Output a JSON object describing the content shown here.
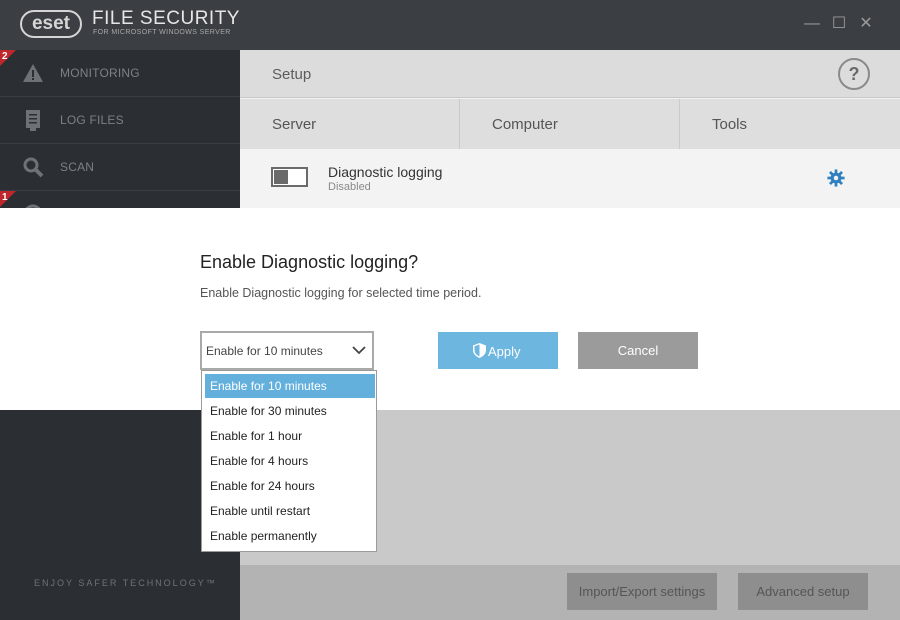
{
  "titlebar": {
    "logo_text": "eset",
    "product_name": "FILE SECURITY",
    "product_subtitle": "FOR MICROSOFT WINDOWS SERVER",
    "minimize_glyph": "—",
    "maximize_glyph": "☐",
    "close_glyph": "✕"
  },
  "sidebar": {
    "items": [
      {
        "label": "MONITORING",
        "icon": "warning-icon",
        "badge": "2"
      },
      {
        "label": "LOG FILES",
        "icon": "log-files-icon",
        "badge": ""
      },
      {
        "label": "SCAN",
        "icon": "search-icon",
        "badge": ""
      },
      {
        "label": "",
        "icon": "update-icon",
        "badge": "1"
      }
    ],
    "tagline": "ENJOY SAFER TECHNOLOGY™"
  },
  "main": {
    "title": "Setup",
    "help_glyph": "?",
    "tabs": [
      {
        "label": "Server"
      },
      {
        "label": "Computer"
      },
      {
        "label": "Tools"
      }
    ],
    "diagnostic_row": {
      "title": "Diagnostic logging",
      "status": "Disabled",
      "enabled": false
    },
    "bottom_buttons": {
      "import_export": "Import/Export settings",
      "advanced_setup": "Advanced setup"
    }
  },
  "modal": {
    "title": "Enable Diagnostic logging?",
    "description": "Enable Diagnostic logging for selected time period.",
    "select_value": "Enable for 10 minutes",
    "apply_label": "Apply",
    "cancel_label": "Cancel",
    "options": [
      "Enable for 10 minutes",
      "Enable for 30 minutes",
      "Enable for 1 hour",
      "Enable for 4 hours",
      "Enable for 24 hours",
      "Enable until restart",
      "Enable permanently"
    ],
    "selected_index": 0
  },
  "colors": {
    "accent": "#64b0dc",
    "badge": "#c0272d",
    "gear": "#2f7fc1"
  }
}
